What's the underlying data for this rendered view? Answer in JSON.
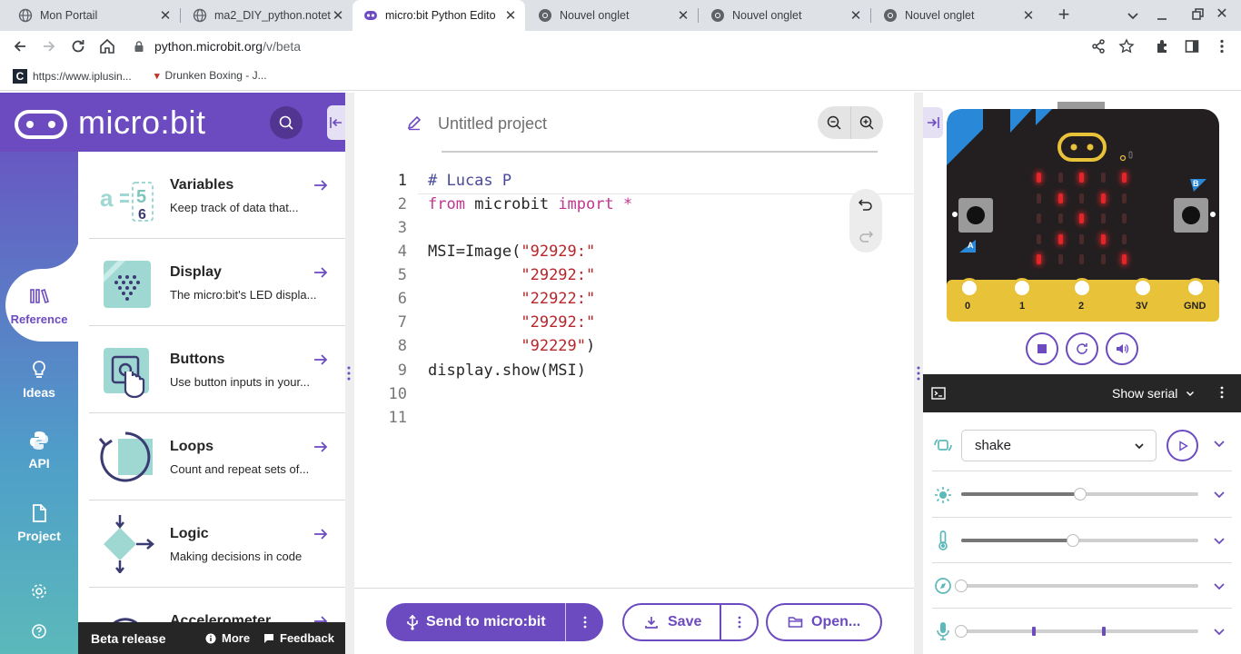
{
  "browser": {
    "tabs": [
      {
        "title": "Mon Portail",
        "active": false
      },
      {
        "title": "ma2_DIY_python.notet",
        "active": false
      },
      {
        "title": "micro:bit Python Edito",
        "active": true
      },
      {
        "title": "Nouvel onglet",
        "active": false
      },
      {
        "title": "Nouvel onglet",
        "active": false
      },
      {
        "title": "Nouvel onglet",
        "active": false
      }
    ],
    "url_host": "python.microbit.org",
    "url_path": "/v/beta",
    "bookmarks": [
      {
        "label": "https://www.iplusin..."
      },
      {
        "label": "Drunken Boxing - J..."
      }
    ]
  },
  "sidebar": {
    "brand": "micro:bit",
    "nav": [
      {
        "label": "Reference",
        "icon": "library-icon"
      },
      {
        "label": "Ideas",
        "icon": "lightbulb-icon"
      },
      {
        "label": "API",
        "icon": "python-icon"
      },
      {
        "label": "Project",
        "icon": "file-icon"
      }
    ],
    "reference_items": [
      {
        "title": "Variables",
        "desc": "Keep track of data that..."
      },
      {
        "title": "Display",
        "desc": "The micro:bit's LED displa..."
      },
      {
        "title": "Buttons",
        "desc": "Use button inputs in your..."
      },
      {
        "title": "Loops",
        "desc": "Count and repeat sets of..."
      },
      {
        "title": "Logic",
        "desc": "Making decisions in code"
      },
      {
        "title": "Accelerometer",
        "desc": ""
      }
    ],
    "footer": {
      "beta": "Beta release",
      "more": "More",
      "feedback": "Feedback"
    }
  },
  "editor": {
    "project_placeholder": "Untitled project",
    "line_numbers": [
      "1",
      "2",
      "3",
      "4",
      "5",
      "6",
      "7",
      "8",
      "9",
      "10",
      "11"
    ],
    "code_lines": [
      "# Lucas P",
      "from microbit import *",
      "",
      "MSI=Image(\"92929:\"",
      "          \"29292:\"",
      "          \"22922:\"",
      "          \"29292:\"",
      "          \"92229\")",
      "display.show(MSI)",
      "",
      ""
    ],
    "buttons": {
      "send": "Send to micro:bit",
      "save": "Save",
      "open": "Open..."
    }
  },
  "simulator": {
    "pins": [
      "0",
      "1",
      "2",
      "3V",
      "GND"
    ],
    "button_a": "A",
    "button_b": "B",
    "led_rows": [
      "92929",
      "29292",
      "22922",
      "29292",
      "92229"
    ],
    "serial_label": "Show serial",
    "gesture": "shake",
    "sensors": [
      {
        "name": "light",
        "icon": "sun-icon",
        "level": 0.5
      },
      {
        "name": "temperature",
        "icon": "thermometer-icon",
        "level": 0.47
      },
      {
        "name": "compass",
        "icon": "compass-icon",
        "level": 0.0
      },
      {
        "name": "sound",
        "icon": "microphone-icon",
        "level": 0.0
      }
    ]
  },
  "colors": {
    "brand_purple": "#6c4bc1",
    "led_red": "#e3252a",
    "board_black": "#231f20",
    "gold": "#e8c239"
  }
}
